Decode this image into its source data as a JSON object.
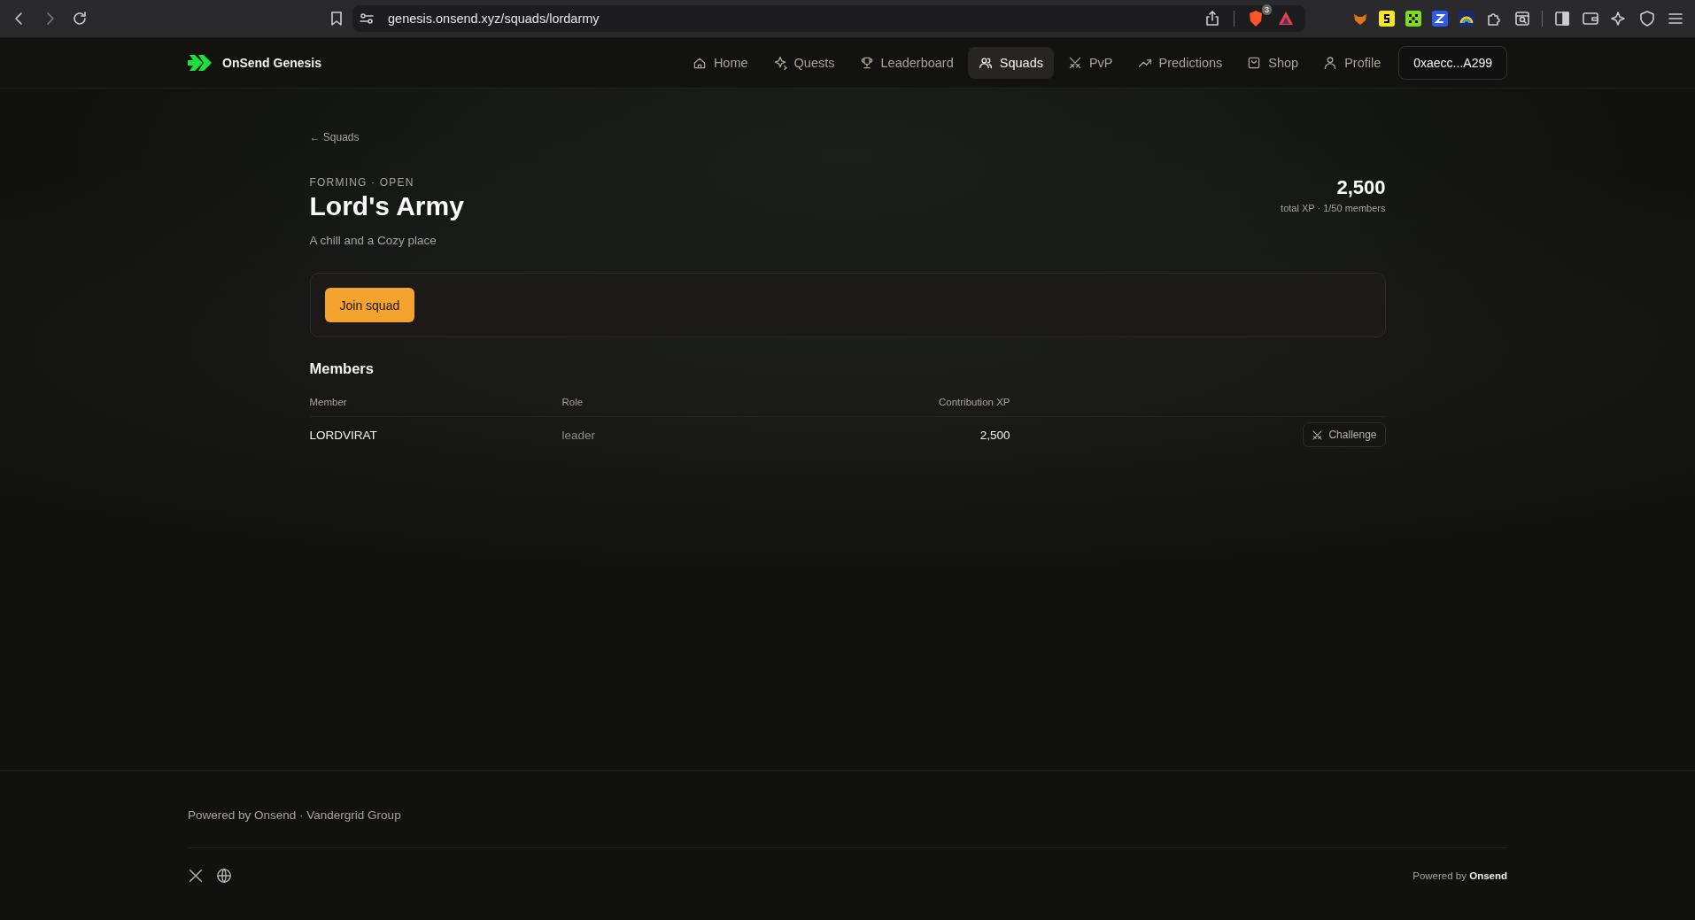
{
  "browser": {
    "url": "genesis.onsend.xyz/squads/lordarmy",
    "shield_badge": "3"
  },
  "nav": {
    "brand": "OnSend Genesis",
    "items": [
      {
        "label": "Home",
        "selected": false
      },
      {
        "label": "Quests",
        "selected": false
      },
      {
        "label": "Leaderboard",
        "selected": false
      },
      {
        "label": "Squads",
        "selected": true
      },
      {
        "label": "PvP",
        "selected": false
      },
      {
        "label": "Predictions",
        "selected": false
      },
      {
        "label": "Shop",
        "selected": false
      },
      {
        "label": "Profile",
        "selected": false
      }
    ],
    "wallet": "0xaecc...A299"
  },
  "breadcrumb": "← Squads",
  "squad": {
    "status": "FORMING · OPEN",
    "name": "Lord's Army",
    "description": "A chill and a Cozy place",
    "total": "2,500",
    "total_caption": "total XP · 1/50 members",
    "join_button": "Join squad"
  },
  "members": {
    "title": "Members",
    "columns": [
      "Member",
      "Role",
      "Contribution XP"
    ],
    "rows": [
      {
        "member": "LORDVIRAT",
        "role": "leader",
        "xp": "2,500",
        "action": "Challenge"
      }
    ]
  },
  "footer": {
    "text": "Powered by Onsend · Vandergrid Group",
    "powered": "Powered by **Onsend**"
  }
}
